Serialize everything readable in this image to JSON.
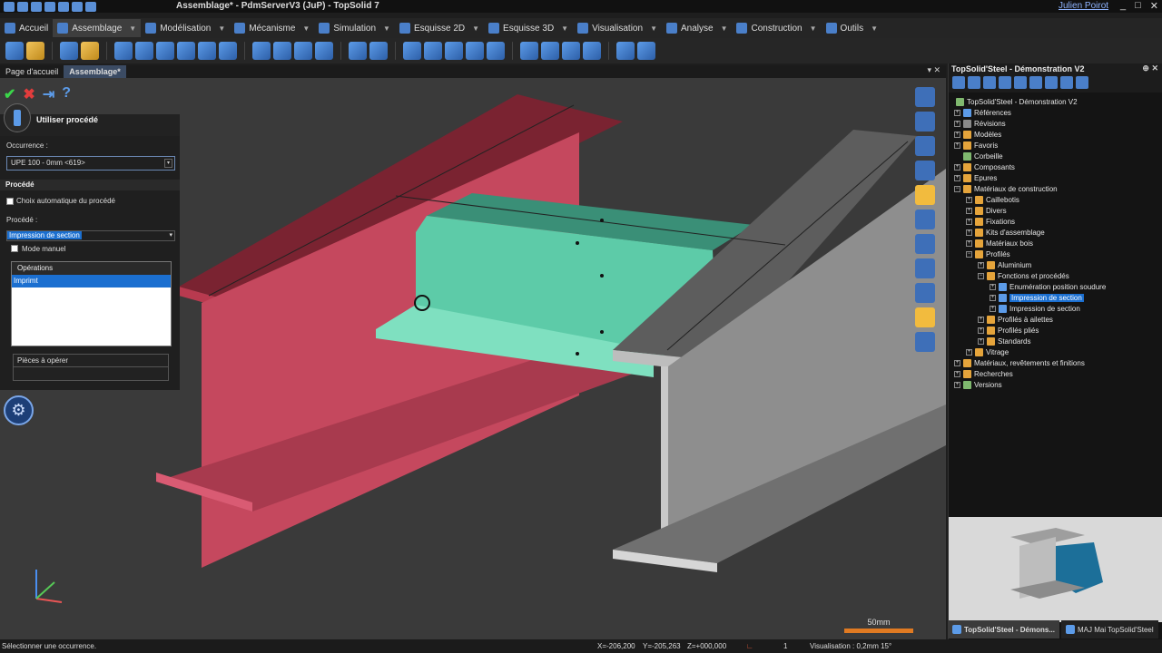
{
  "window": {
    "title": "Assemblage* - PdmServerV3 (JuP) - TopSolid 7",
    "user": "Julien Poirot"
  },
  "menu": [
    {
      "label": "Accueil"
    },
    {
      "label": "Assemblage"
    },
    {
      "label": "Modélisation"
    },
    {
      "label": "Mécanisme"
    },
    {
      "label": "Simulation"
    },
    {
      "label": "Esquisse 2D"
    },
    {
      "label": "Esquisse 3D"
    },
    {
      "label": "Visualisation"
    },
    {
      "label": "Analyse"
    },
    {
      "label": "Construction"
    },
    {
      "label": "Outils"
    }
  ],
  "doc_tabs": {
    "home": "Page d'accueil",
    "active": "Assemblage*"
  },
  "panel": {
    "title": "Utiliser procédé",
    "occurrence_label": "Occurrence :",
    "occurrence_value": "UPE 100 - 0mm <619>",
    "section_procede": "Procédé",
    "auto_choice": "Choix automatique du procédé",
    "procede_label": "Procédé :",
    "procede_value": "Impression de section",
    "manual_mode": "Mode manuel",
    "operations_header": "Opérations",
    "operation_item": "Imprimt",
    "pieces_label": "Pièces à opérer"
  },
  "tree_panel": {
    "title": "TopSolid'Steel - Démonstration V2",
    "nodes": [
      {
        "label": "TopSolid'Steel - Démonstration V2"
      },
      {
        "label": "Références"
      },
      {
        "label": "Révisions"
      },
      {
        "label": "Modèles"
      },
      {
        "label": "Favoris"
      },
      {
        "label": "Corbeille"
      },
      {
        "label": "Composants"
      },
      {
        "label": "Epures"
      },
      {
        "label": "Matériaux de construction"
      },
      {
        "label": "Caillebotis"
      },
      {
        "label": "Divers"
      },
      {
        "label": "Fixations"
      },
      {
        "label": "Kits d'assemblage"
      },
      {
        "label": "Matériaux bois"
      },
      {
        "label": "Profilés"
      },
      {
        "label": "Aluminium"
      },
      {
        "label": "Fonctions et procédés"
      },
      {
        "label": "Enumération position soudure"
      },
      {
        "label": "Impression de section"
      },
      {
        "label": "Impression de section"
      },
      {
        "label": "Profilés à ailettes"
      },
      {
        "label": "Profilés pliés"
      },
      {
        "label": "Standards"
      },
      {
        "label": "Vitrage"
      },
      {
        "label": "Matériaux, revêtements et finitions"
      },
      {
        "label": "Recherches"
      },
      {
        "label": "Versions"
      }
    ]
  },
  "bottom_tabs": {
    "tab1": "TopSolid'Steel - Démons...",
    "tab2": "MAJ Mai TopSolid'Steel"
  },
  "scale": "50mm",
  "status": {
    "message": "Sélectionner une occurrence.",
    "x": "X=-206,200",
    "y": "Y=-205,263",
    "z": "Z=+000,000",
    "count": "1",
    "visualisation": "Visualisation : 0,2mm 15°"
  },
  "colors": {
    "red_beam": "#c5485e",
    "teal_part": "#5dcba8",
    "gray_beam": "#a8a8a8",
    "accent": "#1b6fd0"
  }
}
